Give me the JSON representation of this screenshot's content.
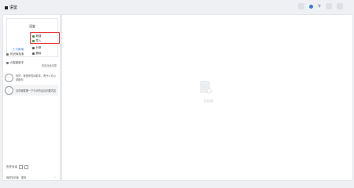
{
  "app": {
    "title": "语鉴"
  },
  "toolbar": {
    "menu_label": "专"
  },
  "menu": {
    "title": "语鉴",
    "items": [
      "新建",
      "导入",
      "分享",
      "删除"
    ],
    "link": "十万新增"
  },
  "sidebar": {
    "rows": [
      "知识库检索",
      "AI智能助手"
    ],
    "note": "历史对话记录",
    "conversations": [
      {
        "text": "你好，我是你的AI助手，有什么可以帮助你"
      },
      {
        "text": "请帮我整理一下今天的会议纪要内容"
      }
    ],
    "bottom_label": "历史对话",
    "footer_left": "我的知识库 · 更多",
    "footer_right": "⋯"
  },
  "main": {
    "empty_text": "暂无内容"
  },
  "colors": {
    "accent": "#3a7bd5",
    "highlight": "#e03b3b",
    "menu_dot": "#2f8f4e"
  }
}
